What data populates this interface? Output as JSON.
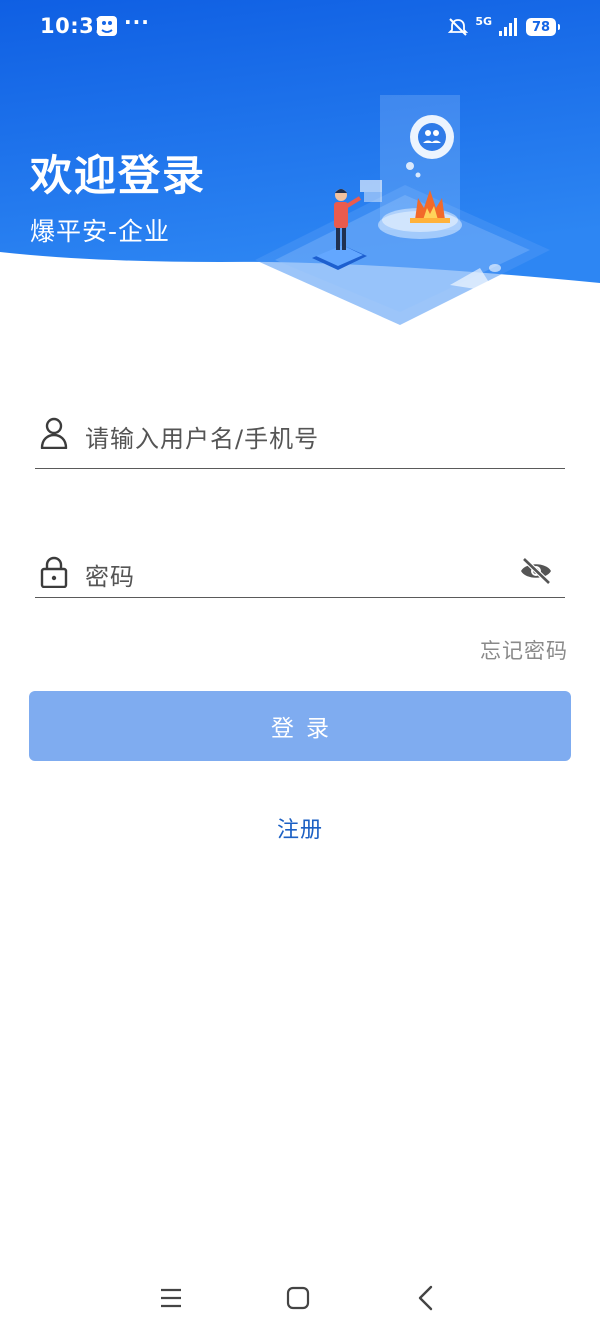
{
  "status_bar": {
    "time": "10:31",
    "more_indicator": "···",
    "network": "5G",
    "battery": "78"
  },
  "header": {
    "title": "欢迎登录",
    "subtitle": "爆平安-企业",
    "illustration": "safety-monitoring-illustration"
  },
  "form": {
    "username_placeholder": "请输入用户名/手机号",
    "password_placeholder": "密码",
    "forgot_label": "忘记密码",
    "login_label": "登录",
    "register_label": "注册"
  },
  "nav": {
    "menu_icon": "menu-icon",
    "home_icon": "home-icon",
    "back_icon": "back-icon"
  },
  "colors": {
    "header_gradient_top": "#0f5fe3",
    "header_gradient_bottom": "#2d86f3",
    "button_bg": "#7facf0",
    "link": "#1c60c4",
    "forgot_text": "#8a8a8a"
  }
}
